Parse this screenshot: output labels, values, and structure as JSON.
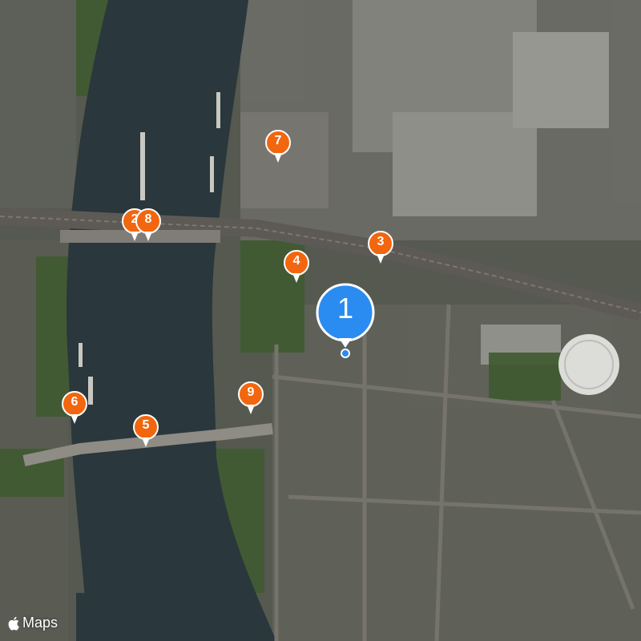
{
  "map": {
    "style": "satellite",
    "colors": {
      "water": "#27353b",
      "land": "#4a5546",
      "urban": "#6b6a63",
      "vegetation": "#3e5a2e",
      "bridge": "#8a8680",
      "rail": "#5e5a55",
      "pin_orange": "#f2660f",
      "pin_blue": "#2a8cf0",
      "attribution_text": "#ffffff"
    },
    "markers": [
      {
        "label": "1",
        "primary": true
      },
      {
        "label": "2"
      },
      {
        "label": "3"
      },
      {
        "label": "4"
      },
      {
        "label": "5"
      },
      {
        "label": "6"
      },
      {
        "label": "7"
      },
      {
        "label": "8"
      },
      {
        "label": "9"
      }
    ],
    "attribution": "Maps"
  }
}
